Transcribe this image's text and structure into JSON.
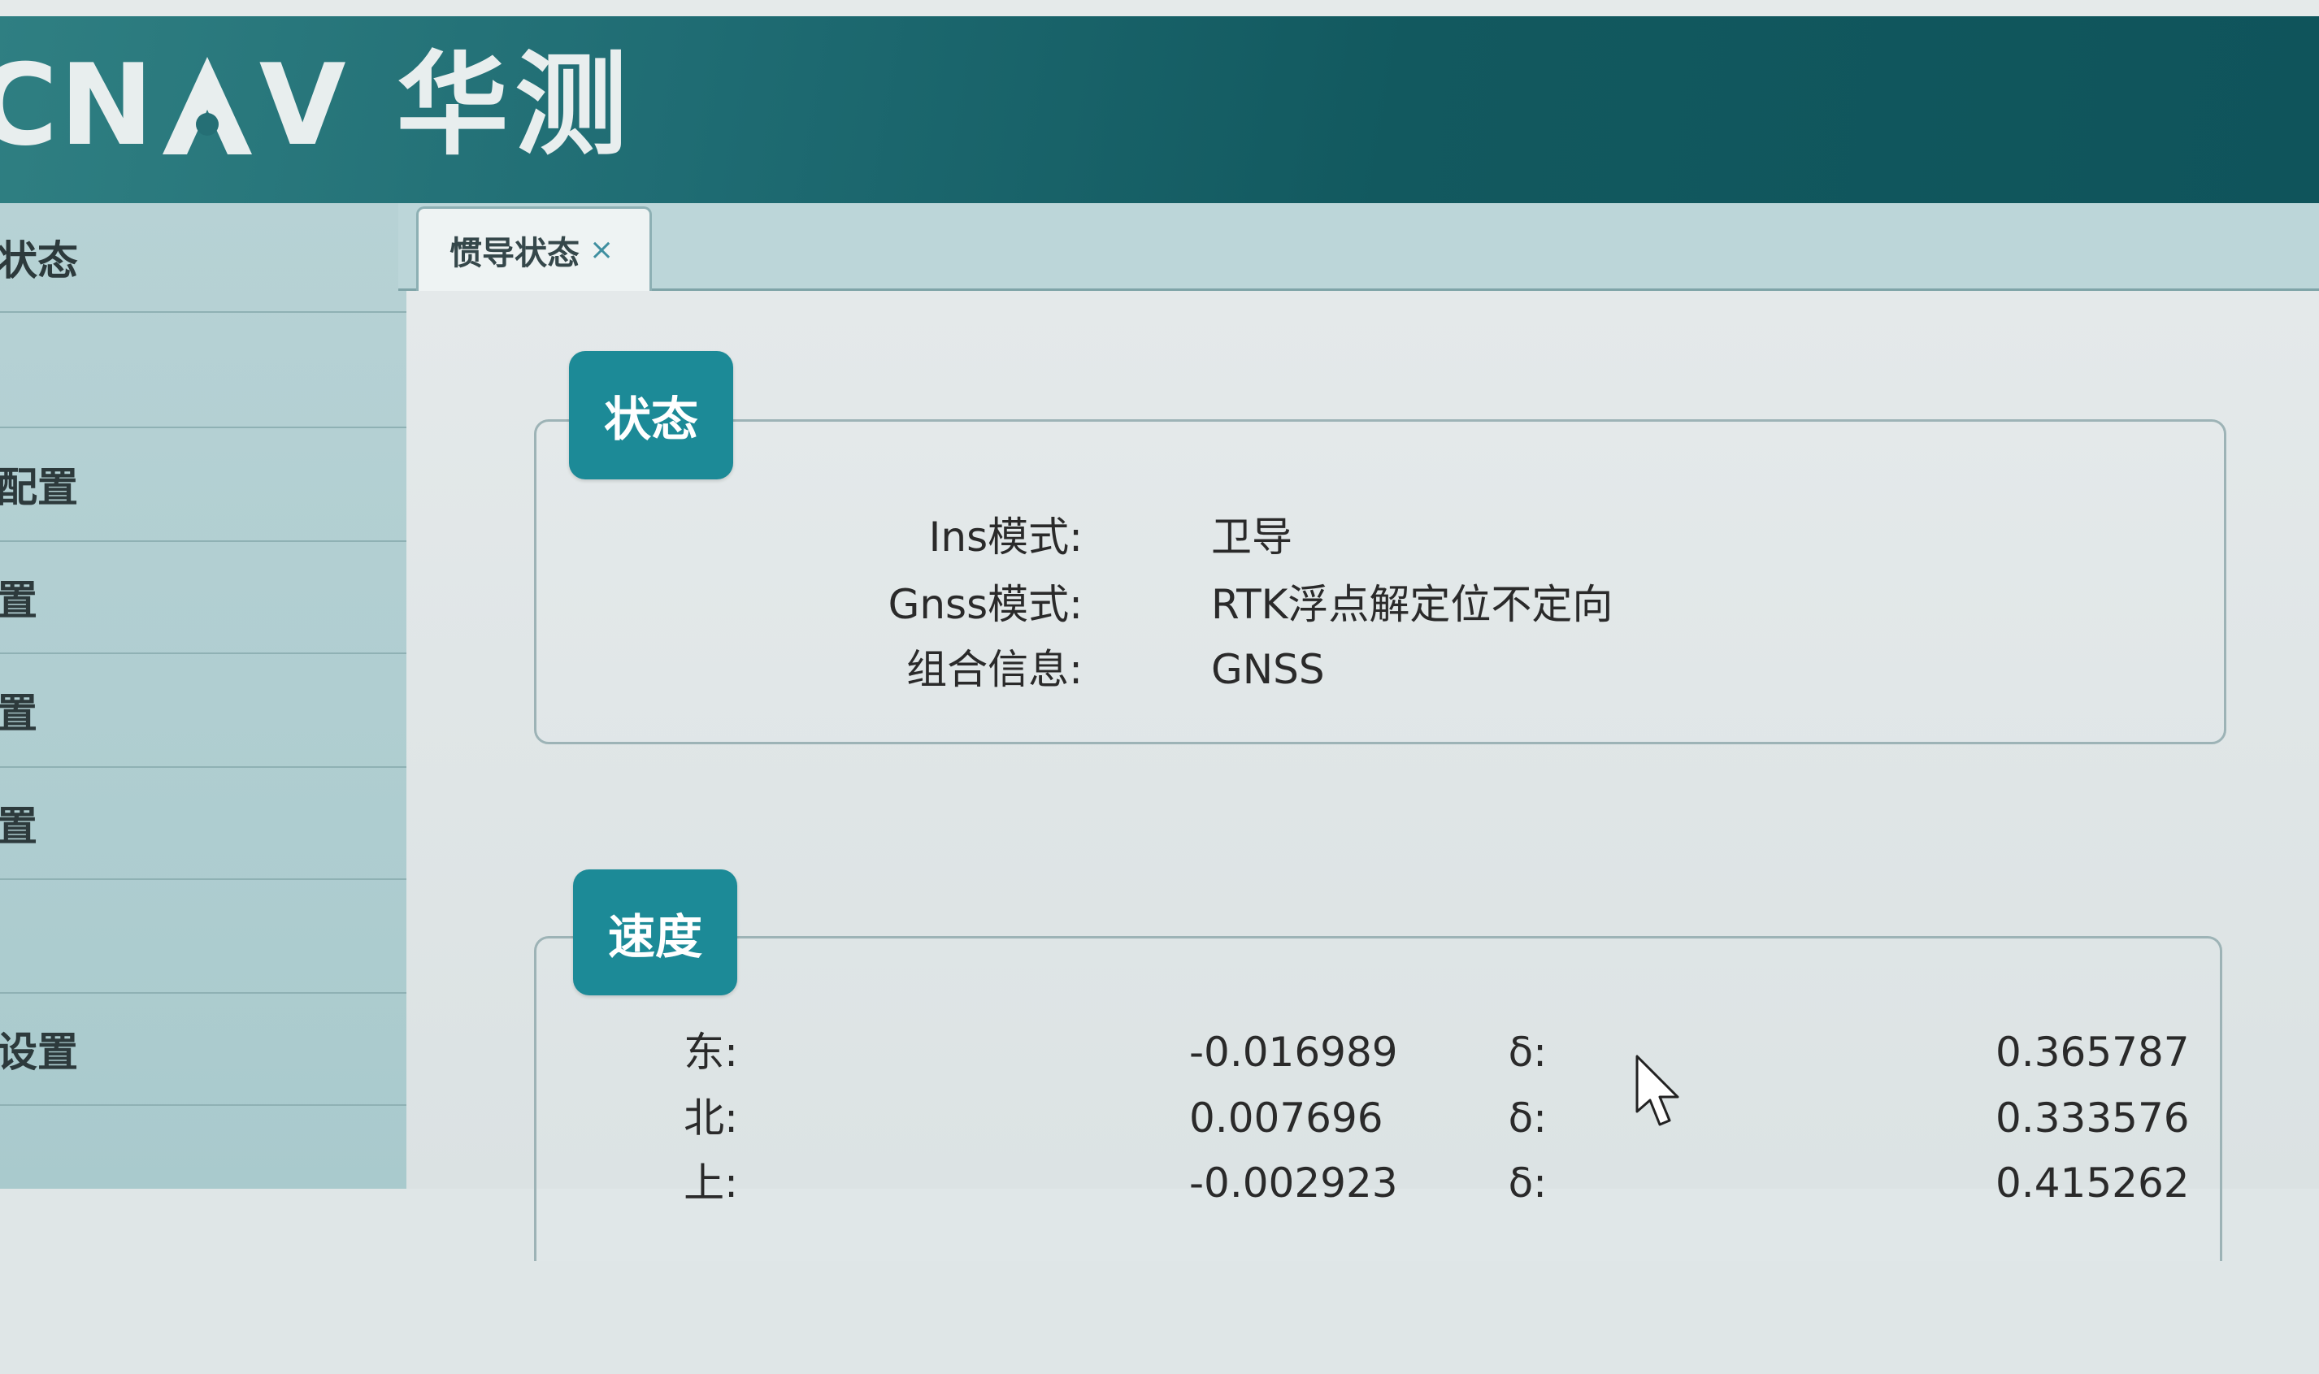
{
  "header": {
    "brand_left": "CN",
    "brand_right": "V",
    "brand_cn": "华测"
  },
  "sidebar": {
    "items": [
      {
        "label": "状态"
      },
      {
        "label": ""
      },
      {
        "label": "配置"
      },
      {
        "label": "置"
      },
      {
        "label": "置"
      },
      {
        "label": "置"
      },
      {
        "label": ""
      },
      {
        "label": "设置"
      }
    ]
  },
  "tabs": [
    {
      "label": "惯导状态",
      "close": "×"
    }
  ],
  "status": {
    "title": "状态",
    "rows": [
      {
        "key": "Ins模式:",
        "value": "卫导"
      },
      {
        "key": "Gnss模式:",
        "value": "RTK浮点解定位不定向"
      },
      {
        "key": "组合信息:",
        "value": "GNSS"
      }
    ]
  },
  "speed": {
    "title": "速度",
    "rows": [
      {
        "key": "东:",
        "value": "-0.016989",
        "sigma_key": "δ:",
        "sigma_value": "0.365787"
      },
      {
        "key": "北:",
        "value": "0.007696",
        "sigma_key": "δ:",
        "sigma_value": "0.333576"
      },
      {
        "key": "上:",
        "value": "-0.002923",
        "sigma_key": "δ:",
        "sigma_value": "0.415262"
      }
    ]
  },
  "colors": {
    "header_start": "#2f7f82",
    "header_end": "#0f545b",
    "badge": "#1c8a97",
    "sidebar": "#b7d2d5",
    "content": "#e4e9ea"
  }
}
